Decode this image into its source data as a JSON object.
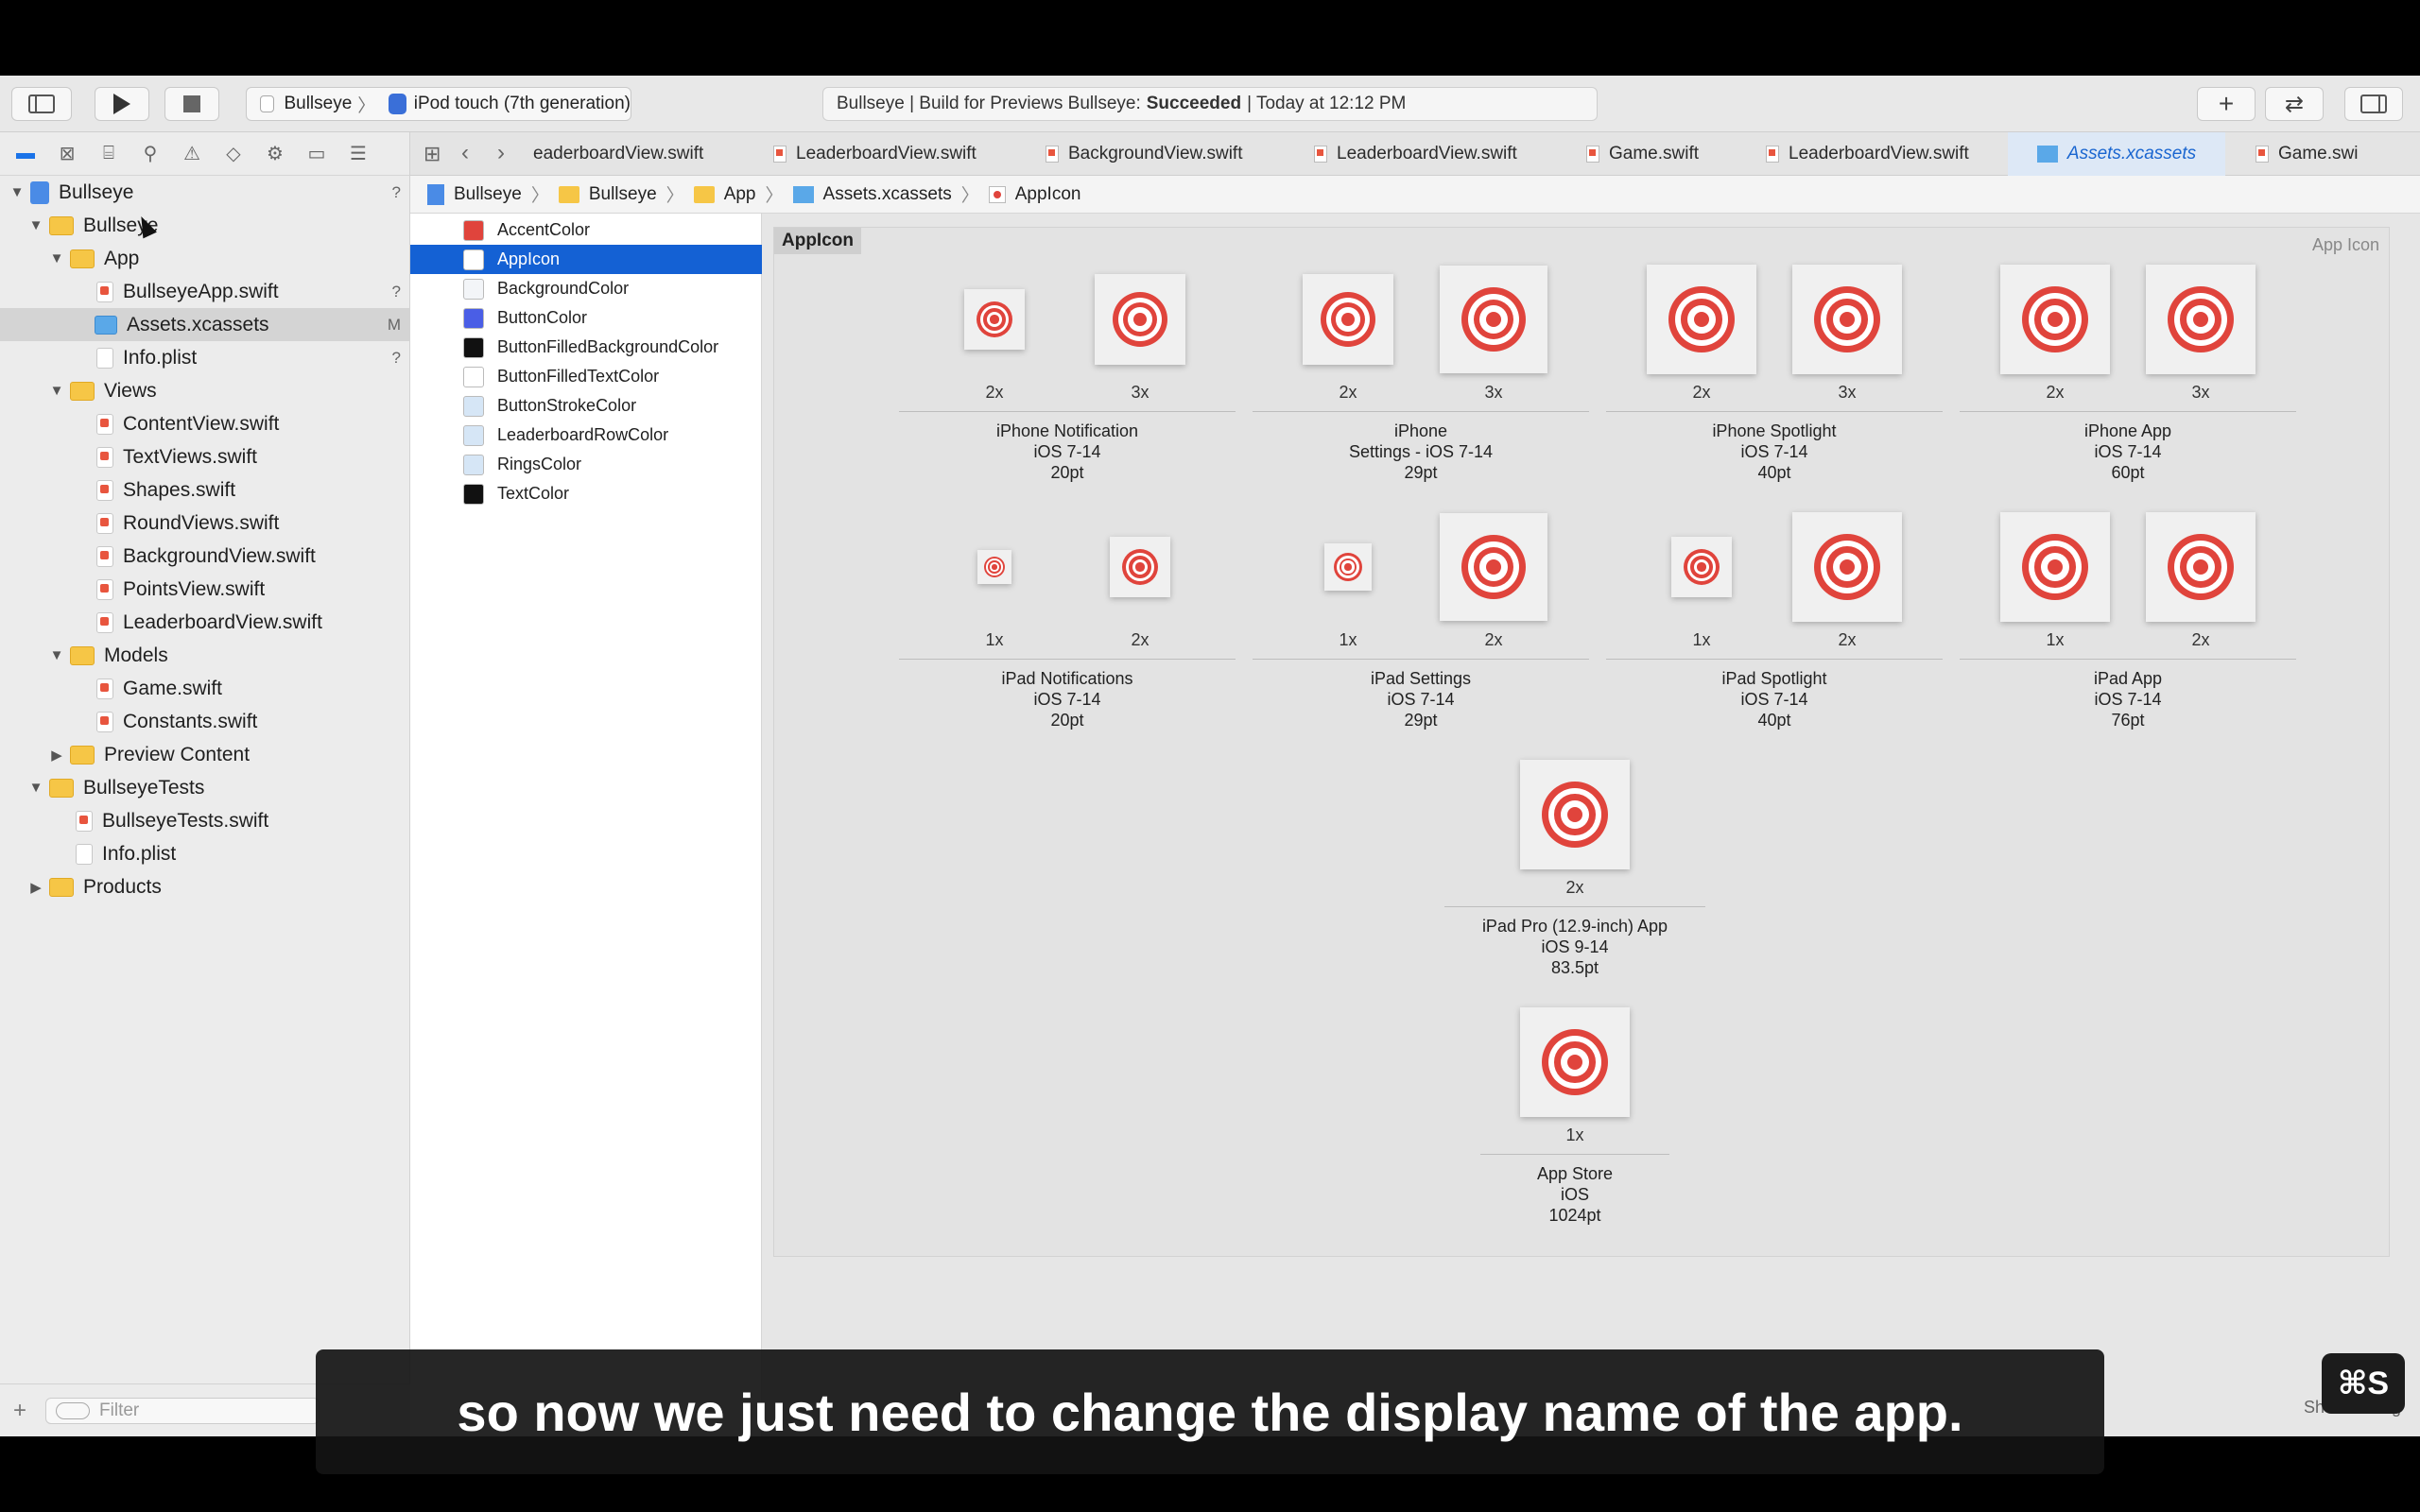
{
  "toolbar": {
    "scheme_project": "Bullseye",
    "scheme_device": "iPod touch (7th generation)",
    "activity_prefix": "Bullseye | Build for Previews Bullseye:",
    "activity_status": "Succeeded",
    "activity_time": "| Today at 12:12 PM"
  },
  "navigator": {
    "rows": [
      {
        "label": "Bullseye",
        "badge": "?"
      },
      {
        "label": "Bullseye",
        "badge": ""
      },
      {
        "label": "App",
        "badge": ""
      },
      {
        "label": "BullseyeApp.swift",
        "badge": "?"
      },
      {
        "label": "Assets.xcassets",
        "badge": "M"
      },
      {
        "label": "Info.plist",
        "badge": "?"
      },
      {
        "label": "Views",
        "badge": ""
      },
      {
        "label": "ContentView.swift",
        "badge": ""
      },
      {
        "label": "TextViews.swift",
        "badge": ""
      },
      {
        "label": "Shapes.swift",
        "badge": ""
      },
      {
        "label": "RoundViews.swift",
        "badge": ""
      },
      {
        "label": "BackgroundView.swift",
        "badge": ""
      },
      {
        "label": "PointsView.swift",
        "badge": ""
      },
      {
        "label": "LeaderboardView.swift",
        "badge": ""
      },
      {
        "label": "Models",
        "badge": ""
      },
      {
        "label": "Game.swift",
        "badge": ""
      },
      {
        "label": "Constants.swift",
        "badge": ""
      },
      {
        "label": "Preview Content",
        "badge": ""
      },
      {
        "label": "BullseyeTests",
        "badge": ""
      },
      {
        "label": "BullseyeTests.swift",
        "badge": ""
      },
      {
        "label": "Info.plist",
        "badge": ""
      },
      {
        "label": "Products",
        "badge": ""
      }
    ],
    "filter_placeholder": "Filter"
  },
  "tabs": [
    "eaderboardView.swift",
    "LeaderboardView.swift",
    "BackgroundView.swift",
    "LeaderboardView.swift",
    "Game.swift",
    "LeaderboardView.swift",
    "Assets.xcassets",
    "Game.swi"
  ],
  "jumpbar": [
    "Bullseye",
    "Bullseye",
    "App",
    "Assets.xcassets",
    "AppIcon"
  ],
  "assets": [
    {
      "label": "AccentColor",
      "color": "#e0443c"
    },
    {
      "label": "AppIcon",
      "color": ""
    },
    {
      "label": "BackgroundColor",
      "color": "#f3f5f8"
    },
    {
      "label": "ButtonColor",
      "color": "#4a5ee6"
    },
    {
      "label": "ButtonFilledBackgroundColor",
      "color": "#111111"
    },
    {
      "label": "ButtonFilledTextColor",
      "color": "#ffffff"
    },
    {
      "label": "ButtonStrokeColor",
      "color": "#d6e6f6"
    },
    {
      "label": "LeaderboardRowColor",
      "color": "#d6e6f6"
    },
    {
      "label": "RingsColor",
      "color": "#d6e6f6"
    },
    {
      "label": "TextColor",
      "color": "#111111"
    }
  ],
  "editor": {
    "title": "AppIcon",
    "right_label": "App Icon",
    "groups": [
      {
        "line1": "iPhone Notification",
        "line2": "iOS 7-14",
        "line3": "20pt",
        "scales": [
          "2x",
          "3x"
        ]
      },
      {
        "line1": "iPhone",
        "line2": "Settings - iOS 7-14",
        "line3": "29pt",
        "scales": [
          "2x",
          "3x"
        ]
      },
      {
        "line1": "iPhone Spotlight",
        "line2": "iOS 7-14",
        "line3": "40pt",
        "scales": [
          "2x",
          "3x"
        ]
      },
      {
        "line1": "iPhone App",
        "line2": "iOS 7-14",
        "line3": "60pt",
        "scales": [
          "2x",
          "3x"
        ]
      },
      {
        "line1": "iPad Notifications",
        "line2": "iOS 7-14",
        "line3": "20pt",
        "scales": [
          "1x",
          "2x"
        ]
      },
      {
        "line1": "iPad Settings",
        "line2": "iOS 7-14",
        "line3": "29pt",
        "scales": [
          "1x",
          "2x"
        ]
      },
      {
        "line1": "iPad Spotlight",
        "line2": "iOS 7-14",
        "line3": "40pt",
        "scales": [
          "1x",
          "2x"
        ]
      },
      {
        "line1": "iPad App",
        "line2": "iOS 7-14",
        "line3": "76pt",
        "scales": [
          "1x",
          "2x"
        ]
      },
      {
        "line1": "iPad Pro (12.9-inch) App",
        "line2": "iOS 9-14",
        "line3": "83.5pt",
        "scales": [
          "2x"
        ]
      },
      {
        "line1": "App Store",
        "line2": "iOS",
        "line3": "1024pt",
        "scales": [
          "1x"
        ]
      }
    ],
    "slicing_label": "Show Slicing"
  },
  "subtitle": "so now we just need to change the display name of the app.",
  "shortcut_badge": "⌘S"
}
